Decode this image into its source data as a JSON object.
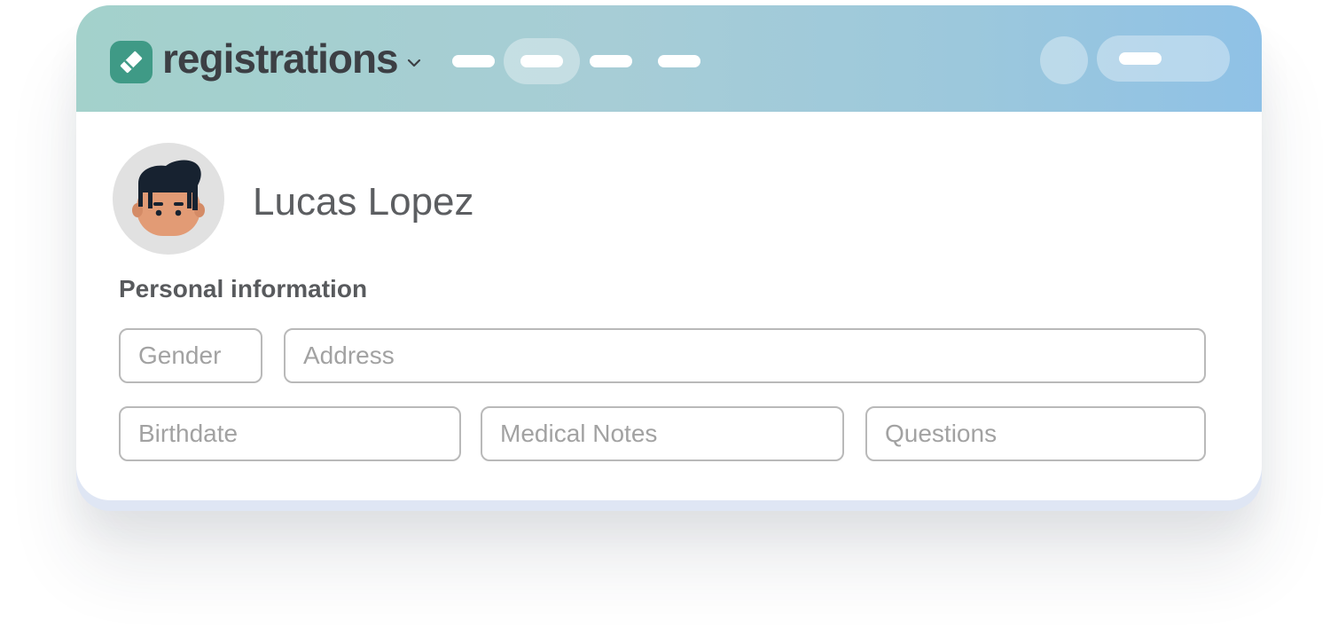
{
  "app": {
    "title": "registrations",
    "logo_icon": "ticket-icon",
    "caret_icon": "chevron-down-icon",
    "brand_color": "#3f9a86"
  },
  "nav": {
    "items": [
      {
        "state": "default"
      },
      {
        "state": "active"
      },
      {
        "state": "default"
      },
      {
        "state": "default"
      }
    ]
  },
  "user": {
    "name": "Lucas Lopez",
    "avatar_icon": "person-avatar"
  },
  "section": {
    "title": "Personal information"
  },
  "fields": {
    "gender": {
      "placeholder": "Gender",
      "value": ""
    },
    "address": {
      "placeholder": "Address",
      "value": ""
    },
    "birthdate": {
      "placeholder": "Birthdate",
      "value": ""
    },
    "medical_notes": {
      "placeholder": "Medical Notes",
      "value": ""
    },
    "questions": {
      "placeholder": "Questions",
      "value": ""
    }
  }
}
